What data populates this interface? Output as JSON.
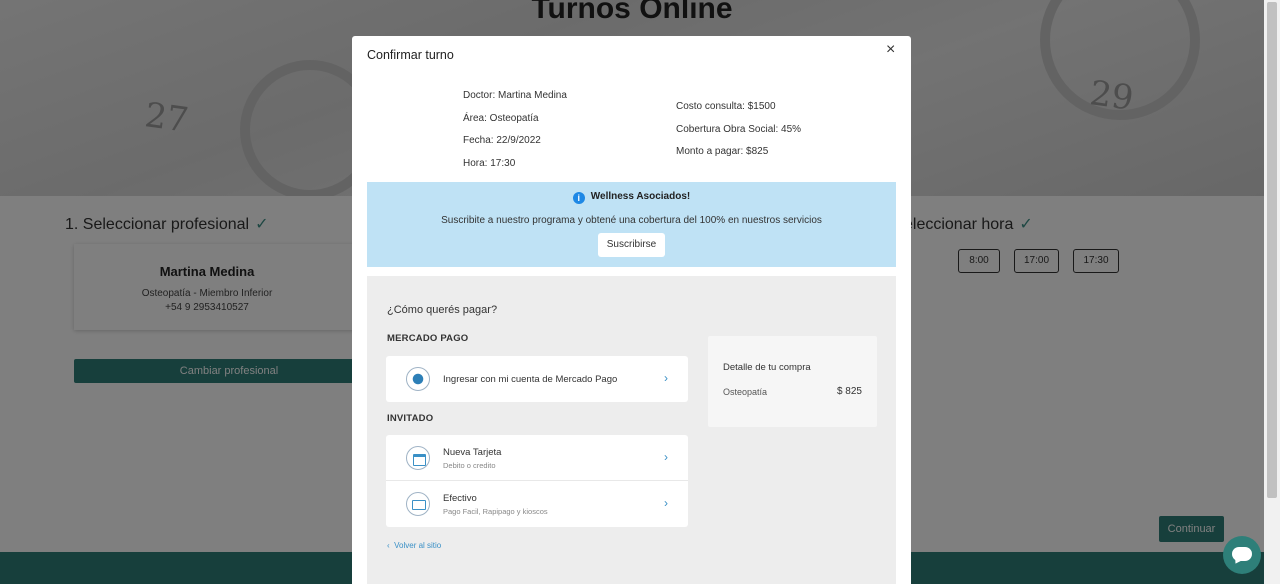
{
  "page": {
    "title": "Turnos Online",
    "hero_numbers": [
      "27",
      "29"
    ],
    "steps": {
      "select_professional": "1. Seleccionar profesional",
      "select_time": "eleccionar hora"
    },
    "doctor_card": {
      "name": "Martina Medina",
      "area": "Osteopatía - Miembro Inferior",
      "phone": "+54 9 2953410527"
    },
    "change_professional_label": "Cambiar profesional",
    "time_slots": [
      "8:00",
      "17:00",
      "17:30"
    ],
    "continue_label": "Continuar"
  },
  "modal": {
    "title": "Confirmar turno",
    "close_label": "×",
    "appointment": {
      "doctor": "Doctor: Martina Medina",
      "area": "Área: Osteopatía",
      "date": "Fecha: 22/9/2022",
      "time": "Hora: 17:30"
    },
    "costs": {
      "consult": "Costo consulta: $1500",
      "coverage": "Cobertura Obra Social: 45%",
      "to_pay": "Monto a pagar: $825"
    },
    "promo": {
      "icon": "info-icon",
      "title": "Wellness Asociados!",
      "text": "Suscribite a nuestro programa y obtené una cobertura del 100% en nuestros servicios",
      "button": "Suscribirse"
    },
    "payment": {
      "question": "¿Cómo querés pagar?",
      "mp_section": "MERCADO PAGO",
      "mp_option": "Ingresar con mi cuenta de Mercado Pago",
      "guest_section": "INVITADO",
      "card_title": "Nueva Tarjeta",
      "card_sub": "Debito o credito",
      "cash_title": "Efectivo",
      "cash_sub": "Pago Facil, Rapipago y kioscos",
      "back_link": "Volver al sitio",
      "back_icon": "‹",
      "chevron": "›"
    },
    "purchase_detail": {
      "title": "Detalle de tu compra",
      "item": "Osteopatía",
      "price": "$ 825"
    }
  },
  "colors": {
    "brand_teal": "#2e7f79",
    "promo_blue": "#bfe2f5",
    "link_blue": "#3a90c6"
  }
}
